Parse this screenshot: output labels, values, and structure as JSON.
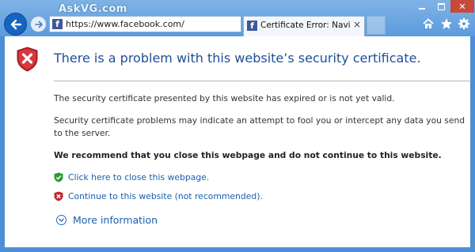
{
  "watermark": "AskVG.com",
  "address_bar": {
    "url": "https://www.facebook.com/"
  },
  "tab": {
    "title": "Certificate Error: Navigation...",
    "favicon_letter": "f"
  },
  "page": {
    "title": "There is a problem with this website’s security certificate.",
    "paragraph1": "The security certificate presented by this website has expired or is not yet valid.",
    "paragraph2": "Security certificate problems may indicate an attempt to fool you or intercept any data you send to the server.",
    "recommendation": "We recommend that you close this webpage and do not continue to this website.",
    "close_link": "Click here to close this webpage.",
    "continue_link": "Continue to this website (not recommended).",
    "more_info": "More information"
  },
  "colors": {
    "frame": "#4d8fd6",
    "title": "#1f4e99",
    "link": "#1a5fae",
    "error_shield": "#c0272d",
    "ok_shield": "#2e9a35",
    "close_button": "#c7493a"
  },
  "icons": {
    "back": "back-arrow-icon",
    "forward": "forward-arrow-icon",
    "search": "search-icon",
    "refresh": "refresh-icon",
    "home": "home-icon",
    "favorites": "star-icon",
    "tools": "gear-icon",
    "error": "error-shield-icon",
    "ok": "check-shield-icon",
    "more": "chevron-down-circle-icon"
  }
}
